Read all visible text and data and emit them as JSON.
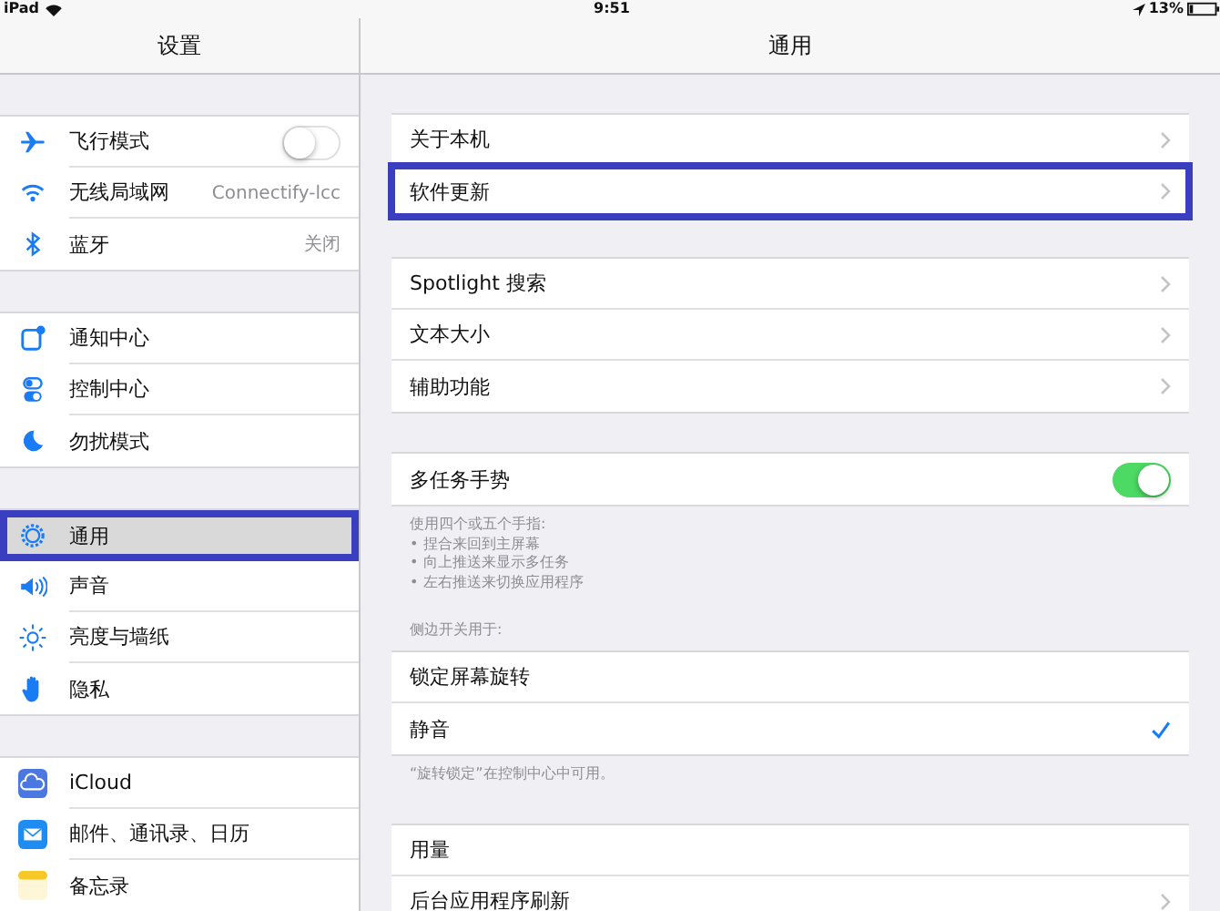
{
  "status_bar": {
    "device": "iPad",
    "time": "9:51",
    "battery": "13%"
  },
  "sidebar": {
    "title": "设置",
    "sections": [
      {
        "items": [
          {
            "label": "飞行模式",
            "kind": "switch",
            "on": false,
            "selected": false,
            "highlighted": false
          },
          {
            "label": "无线局域网",
            "kind": "value",
            "value": "Connectify-lcc",
            "selected": false,
            "highlighted": false
          },
          {
            "label": "蓝牙",
            "kind": "value",
            "value": "关闭",
            "selected": false,
            "highlighted": false
          }
        ]
      },
      {
        "items": [
          {
            "label": "通知中心",
            "kind": "plain",
            "selected": false,
            "highlighted": false
          },
          {
            "label": "控制中心",
            "kind": "plain",
            "selected": false,
            "highlighted": false
          },
          {
            "label": "勿扰模式",
            "kind": "plain",
            "selected": false,
            "highlighted": false
          }
        ]
      },
      {
        "items": [
          {
            "label": "通用",
            "kind": "plain",
            "selected": true,
            "highlighted": true
          },
          {
            "label": "声音",
            "kind": "plain",
            "selected": false,
            "highlighted": false
          },
          {
            "label": "亮度与墙纸",
            "kind": "plain",
            "selected": false,
            "highlighted": false
          },
          {
            "label": "隐私",
            "kind": "plain",
            "selected": false,
            "highlighted": false
          }
        ]
      },
      {
        "items": [
          {
            "label": "iCloud",
            "kind": "plain",
            "selected": false,
            "highlighted": false
          },
          {
            "label": "邮件、通讯录、日历",
            "kind": "plain",
            "selected": false,
            "highlighted": false
          },
          {
            "label": "备忘录",
            "kind": "plain",
            "selected": false,
            "highlighted": false
          }
        ]
      }
    ]
  },
  "detail": {
    "title": "通用",
    "sections": [
      {
        "items": [
          {
            "label": "关于本机",
            "kind": "link",
            "highlighted": false
          },
          {
            "label": "软件更新",
            "kind": "link",
            "highlighted": true
          }
        ]
      },
      {
        "items": [
          {
            "label": "Spotlight 搜索",
            "kind": "link",
            "highlighted": false
          },
          {
            "label": "文本大小",
            "kind": "link",
            "highlighted": false
          },
          {
            "label": "辅助功能",
            "kind": "link",
            "highlighted": false
          }
        ]
      },
      {
        "items": [
          {
            "label": "多任务手势",
            "kind": "switch",
            "on": true,
            "highlighted": false
          }
        ],
        "footer": [
          "使用四个或五个手指:",
          "• 捏合来回到主屏幕",
          "• 向上推送来显示多任务",
          "• 左右推送来切换应用程序"
        ]
      },
      {
        "header": "侧边开关用于:",
        "items": [
          {
            "label": "锁定屏幕旋转",
            "kind": "check",
            "selected": false,
            "highlighted": false
          },
          {
            "label": "静音",
            "kind": "check",
            "selected": true,
            "highlighted": false
          }
        ],
        "footer": [
          "“旋转锁定”在控制中心中可用。"
        ]
      },
      {
        "items": [
          {
            "label": "用量",
            "kind": "plain",
            "highlighted": false
          },
          {
            "label": "后台应用程序刷新",
            "kind": "link",
            "highlighted": false
          }
        ]
      }
    ]
  }
}
